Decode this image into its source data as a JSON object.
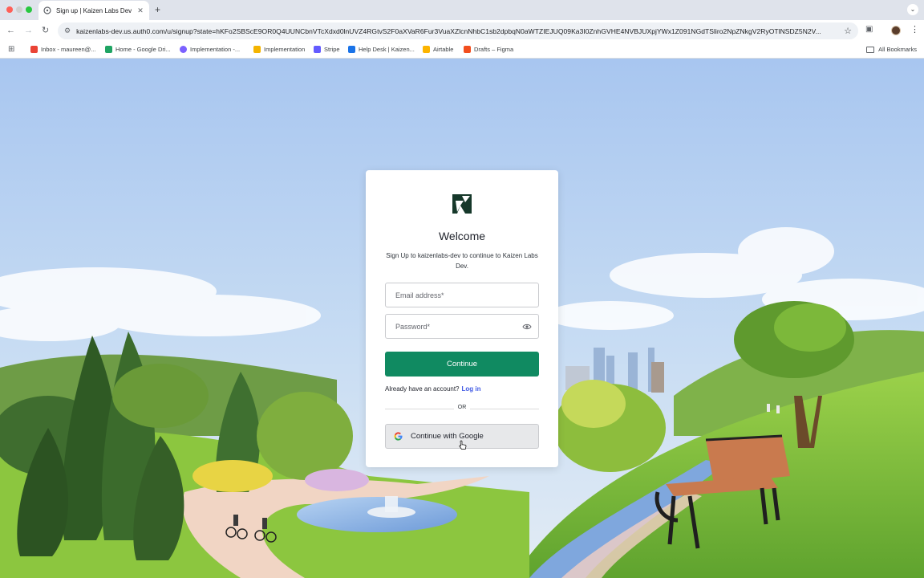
{
  "browser": {
    "tab_title": "Sign up | Kaizen Labs Dev",
    "url": "kaizenlabs-dev.us.auth0.com/u/signup?state=hKFo2SBScE9OR0Q4UUNCbnVTcXdxd0lnUVZ4RGtvS2F0aXVaR6Fur3VuaXZlcnNhbC1sb2dpbqN0aWTZIEJUQ09Ka3I0ZnhGVHE4NVBJUXpjYWx1Z091NGdTSliro2NpZNkgV2RyOTlNSDZ5N2V...",
    "bookmarks": [
      {
        "label": "Inbox - maureen@...",
        "color": "#ea4335"
      },
      {
        "label": "Home - Google Dri...",
        "color": "#1fa463"
      },
      {
        "label": "Implementation -...",
        "color": "#7b61ff"
      },
      {
        "label": "Implementation",
        "color": "#f4b400"
      },
      {
        "label": "Stripe",
        "color": "#635bff"
      },
      {
        "label": "Help Desk | Kaizen...",
        "color": "#1a73e8"
      },
      {
        "label": "Airtable",
        "color": "#fcb400"
      },
      {
        "label": "Drafts – Figma",
        "color": "#f24e1e"
      }
    ],
    "all_bookmarks": "All Bookmarks"
  },
  "card": {
    "heading": "Welcome",
    "subtitle": "Sign Up to kaizenlabs-dev to continue to Kaizen Labs Dev.",
    "email_placeholder": "Email address*",
    "password_placeholder": "Password*",
    "continue_label": "Continue",
    "already_text": "Already have an account?",
    "login_link": "Log in",
    "or_text": "OR",
    "google_label": "Continue with Google"
  },
  "colors": {
    "primary": "#108a61",
    "link": "#3f59e4",
    "sky": "#a9c9ef",
    "grass": "#8cc63f"
  }
}
